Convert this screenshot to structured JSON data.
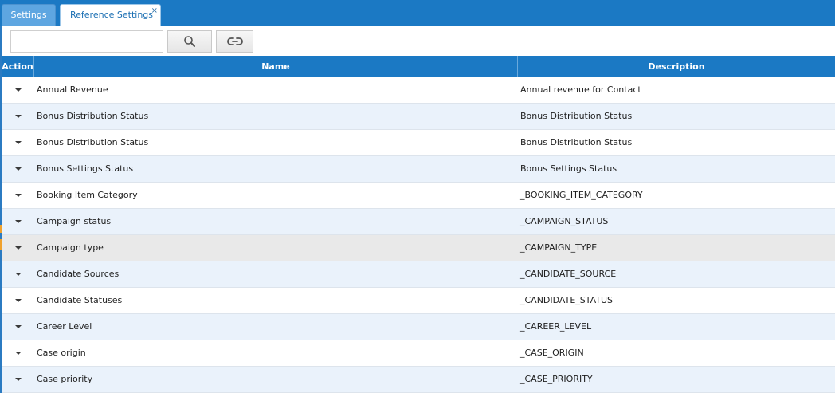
{
  "tabs": [
    {
      "label": "Settings",
      "active": false
    },
    {
      "label": "Reference Settings",
      "active": true,
      "close_glyph": "×"
    }
  ],
  "toolbar": {
    "search_value": "",
    "search_placeholder": "",
    "search_button_icon": "search-icon",
    "link_button_icon": "link-icon"
  },
  "grid": {
    "columns": [
      "Action",
      "Name",
      "Description"
    ],
    "rows": [
      {
        "name": "Annual Revenue",
        "description": "Annual revenue for Contact"
      },
      {
        "name": "Bonus Distribution Status",
        "description": "Bonus Distribution Status"
      },
      {
        "name": "Bonus Distribution Status",
        "description": "Bonus Distribution Status"
      },
      {
        "name": "Bonus Settings Status",
        "description": "Bonus Settings Status"
      },
      {
        "name": "Booking Item Category",
        "description": "_BOOKING_ITEM_CATEGORY"
      },
      {
        "name": "Campaign status",
        "description": "_CAMPAIGN_STATUS"
      },
      {
        "name": "Campaign type",
        "description": "_CAMPAIGN_TYPE"
      },
      {
        "name": "Candidate Sources",
        "description": "_CANDIDATE_SOURCE"
      },
      {
        "name": "Candidate Statuses",
        "description": "_CANDIDATE_STATUS"
      },
      {
        "name": "Career Level",
        "description": "_CAREER_LEVEL"
      },
      {
        "name": "Case origin",
        "description": "_CASE_ORIGIN"
      },
      {
        "name": "Case priority",
        "description": "_CASE_PRIORITY"
      }
    ]
  },
  "colors": {
    "header_blue": "#1b79c4",
    "row_alt": "#eaf2fb",
    "row_hover": "#e9e9e9"
  }
}
